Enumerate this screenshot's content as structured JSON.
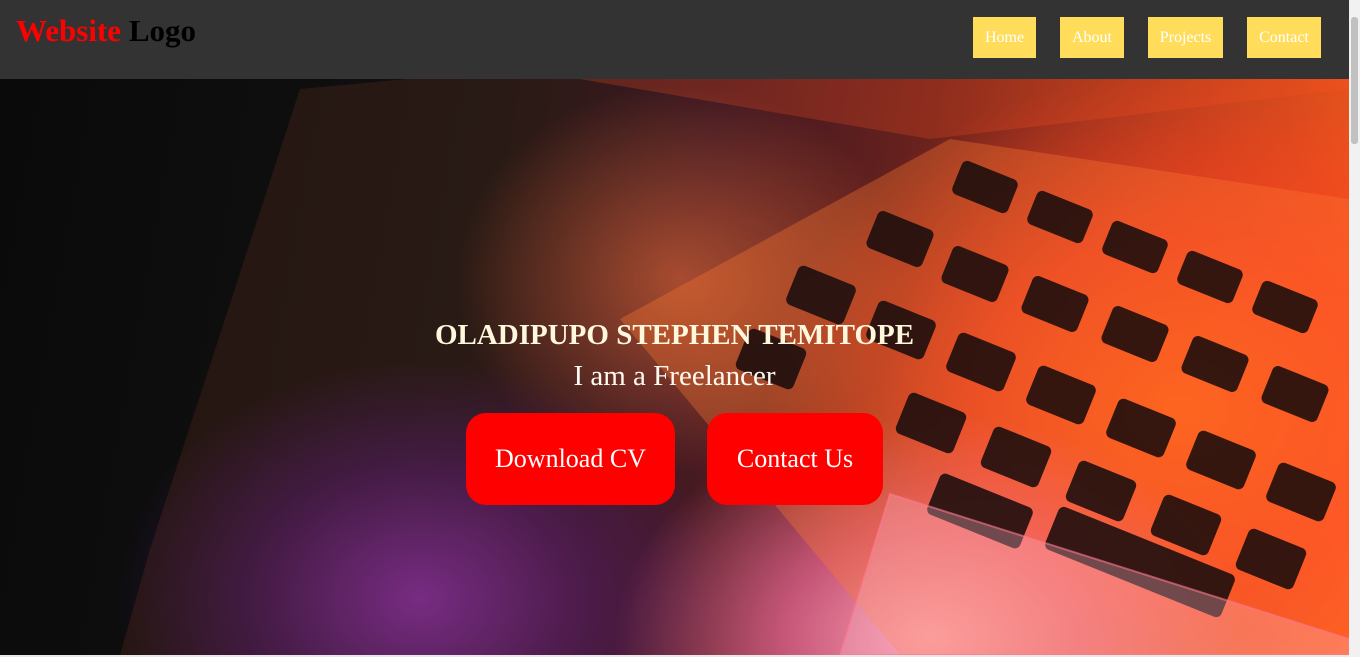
{
  "header": {
    "logo_accent": "Website",
    "logo_rest": " Logo",
    "nav": [
      {
        "label": "Home"
      },
      {
        "label": "About"
      },
      {
        "label": "Projects"
      },
      {
        "label": "Contact"
      }
    ]
  },
  "hero": {
    "name": "OLADIPUPO STEPHEN TEMITOPE",
    "tagline": "I am a Freelancer",
    "buttons": [
      {
        "label": "Download CV"
      },
      {
        "label": "Contact Us"
      }
    ],
    "background_description_icon": "laptop-keyboard-photo"
  },
  "colors": {
    "header_bg": "#333333",
    "logo_accent": "#ff0000",
    "nav_button_bg": "#ffdc5a",
    "cta_bg": "#ff0000"
  }
}
